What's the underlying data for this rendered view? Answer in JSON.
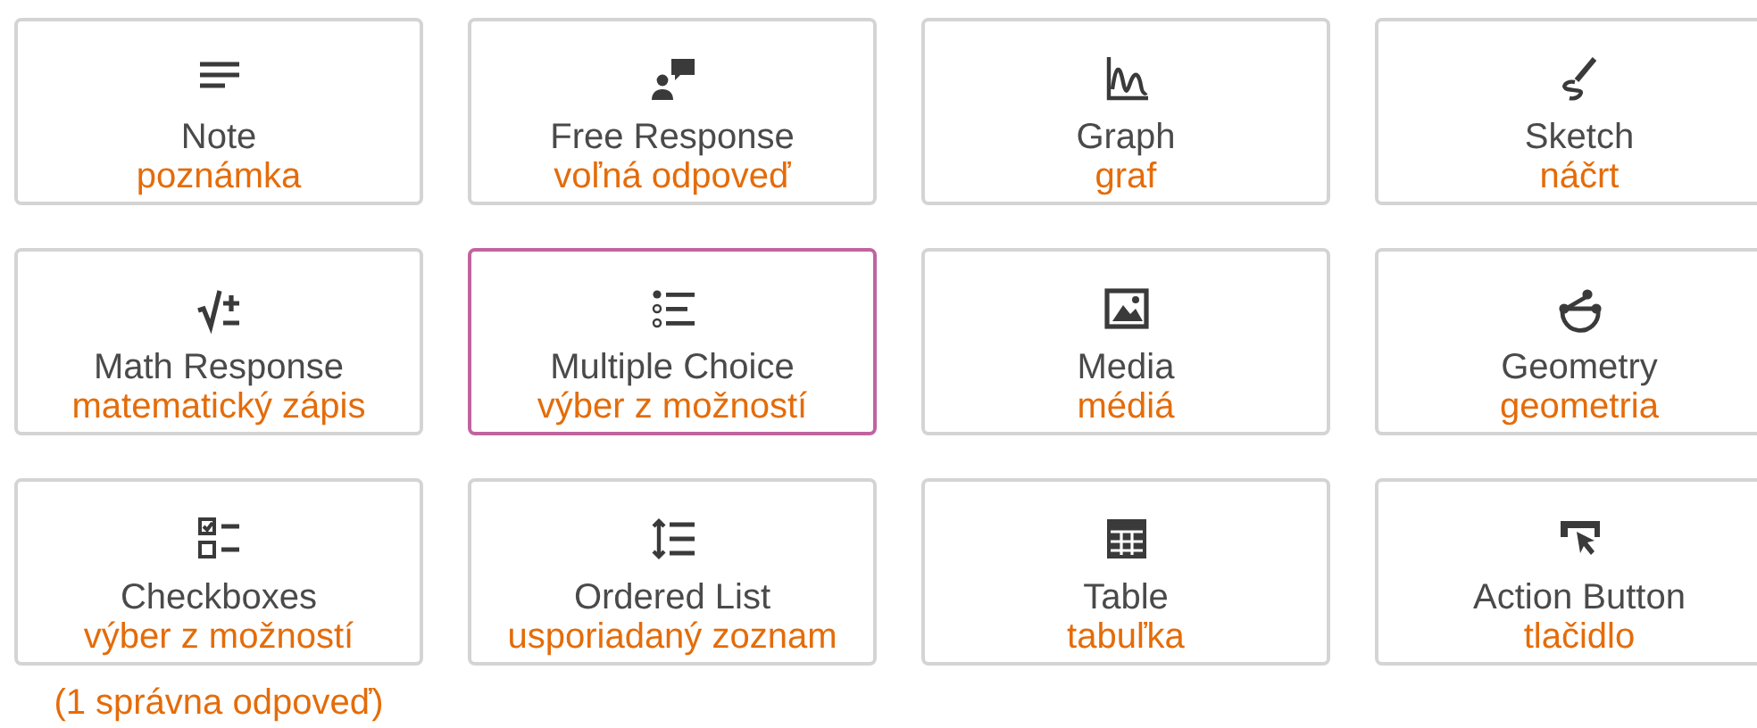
{
  "cards": [
    {
      "kind": "note",
      "label": "Note",
      "translation": "poznámka",
      "selected": false
    },
    {
      "kind": "free-response",
      "label": "Free Response",
      "translation": "voľná odpoveď",
      "selected": false
    },
    {
      "kind": "graph",
      "label": "Graph",
      "translation": "graf",
      "selected": false
    },
    {
      "kind": "sketch",
      "label": "Sketch",
      "translation": "náčrt",
      "selected": false
    },
    {
      "kind": "math",
      "label": "Math Response",
      "translation": "matematický zápis",
      "selected": false
    },
    {
      "kind": "multiple-choice",
      "label": "Multiple Choice",
      "translation": "výber z možností",
      "selected": true
    },
    {
      "kind": "media",
      "label": "Media",
      "translation": "médiá",
      "selected": false
    },
    {
      "kind": "geometry",
      "label": "Geometry",
      "translation": "geometria",
      "selected": false
    },
    {
      "kind": "checkboxes",
      "label": "Checkboxes",
      "translation": "výber z možností",
      "selected": false
    },
    {
      "kind": "ordered-list",
      "label": "Ordered List",
      "translation": "usporiadaný zoznam",
      "selected": false
    },
    {
      "kind": "table",
      "label": "Table",
      "translation": "tabuľka",
      "selected": false
    },
    {
      "kind": "action-button",
      "label": "Action Button",
      "translation": "tlačidlo",
      "selected": false
    }
  ],
  "footnote": "(1 správna odpoveď)"
}
